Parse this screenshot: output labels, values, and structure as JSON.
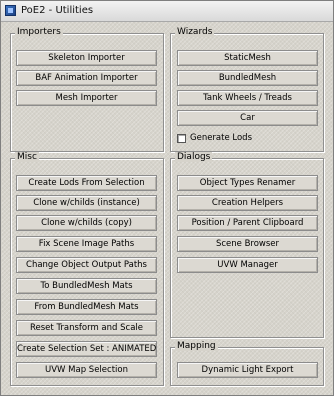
{
  "window": {
    "title": "PoE2 - Utilities"
  },
  "importers": {
    "label": "Importers",
    "buttons": [
      "Skeleton Importer",
      "BAF Animation Importer",
      "Mesh Importer"
    ]
  },
  "wizards": {
    "label": "Wizards",
    "buttons": [
      "StaticMesh",
      "BundledMesh",
      "Tank Wheels / Treads",
      "Car"
    ],
    "checkbox": {
      "label": "Generate Lods",
      "checked": false
    }
  },
  "misc": {
    "label": "Misc",
    "buttons": [
      "Create Lods From Selection",
      "Clone w/childs (instance)",
      "Clone w/childs (copy)",
      "Fix Scene Image Paths",
      "Change Object Output Paths",
      "To BundledMesh Mats",
      "From BundledMesh Mats",
      "Reset Transform and Scale",
      "Create Selection Set : ANIMATED",
      "UVW Map Selection"
    ]
  },
  "dialogs": {
    "label": "Dialogs",
    "buttons": [
      "Object Types Renamer",
      "Creation Helpers",
      "Position / Parent Clipboard",
      "Scene Browser",
      "UVW Manager"
    ]
  },
  "mapping": {
    "label": "Mapping",
    "buttons": [
      "Dynamic Light Export"
    ]
  }
}
